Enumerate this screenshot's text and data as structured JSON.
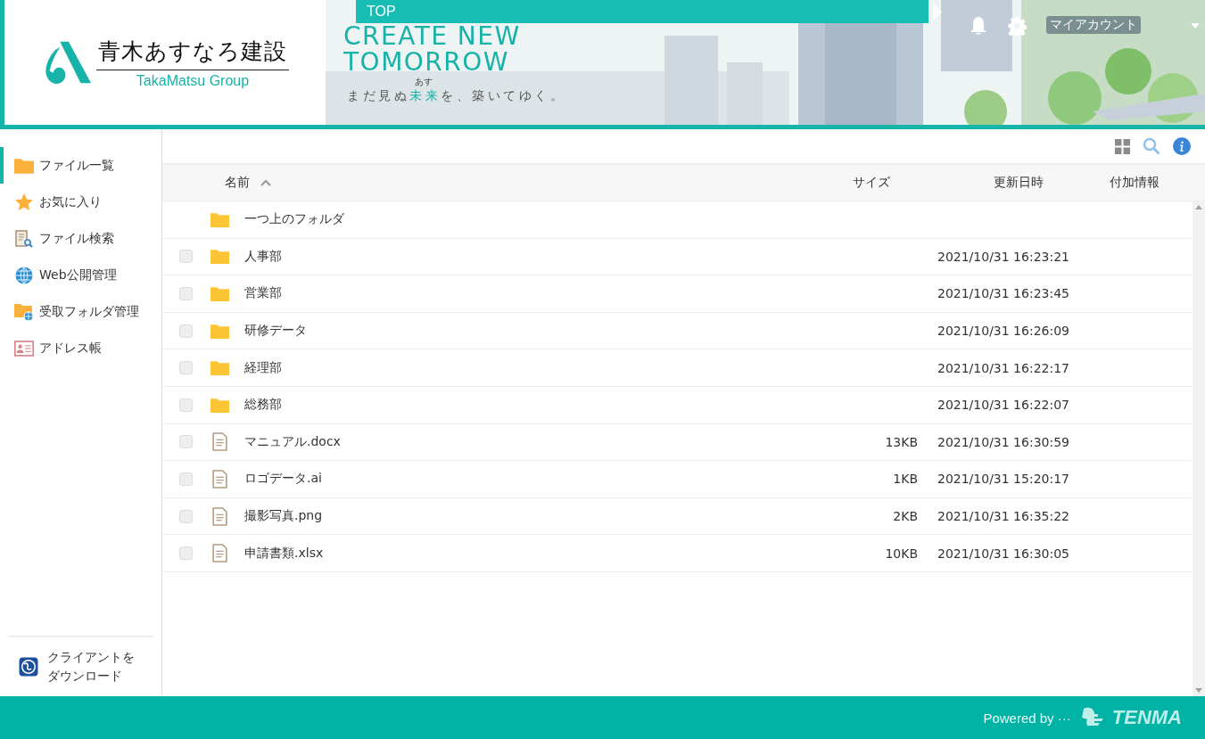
{
  "header": {
    "logo": {
      "name": "青木あすなろ建設",
      "group": "TakaMatsu Group"
    },
    "nav_label": "TOP",
    "banner": {
      "headline": [
        "CREATE NEW",
        "TOMORROW"
      ],
      "tagline": "まだ見ぬ**未来**を、築いてゆく。",
      "ruby": "あす"
    },
    "account": "マイアカウント"
  },
  "sidebar": {
    "items": [
      {
        "label": "ファイル一覧",
        "kind": "folder",
        "selected": true
      },
      {
        "label": "お気に入り",
        "kind": "star",
        "selected": false
      },
      {
        "label": "ファイル検索",
        "kind": "search",
        "selected": false
      },
      {
        "label": "Web公開管理",
        "kind": "globe",
        "selected": false
      },
      {
        "label": "受取フォルダ管理",
        "kind": "inbox",
        "selected": false
      },
      {
        "label": "アドレス帳",
        "kind": "contacts",
        "selected": false
      }
    ],
    "download": [
      "クライアントを",
      "ダウンロード"
    ]
  },
  "table": {
    "columns": [
      {
        "label": "名前",
        "sorted": true
      },
      {
        "label": "サイズ",
        "sorted": false
      },
      {
        "label": "更新日時",
        "sorted": false
      },
      {
        "label": "付加情報",
        "sorted": false
      }
    ],
    "rows": [
      {
        "kind": "parent",
        "name": "一つ上のフォルダ"
      },
      {
        "kind": "folder",
        "name": "人事部",
        "date": "2021/10/31 16:23:21",
        "checked": false
      },
      {
        "kind": "folder",
        "name": "営業部",
        "date": "2021/10/31 16:23:45",
        "checked": false
      },
      {
        "kind": "folder",
        "name": "研修データ",
        "date": "2021/10/31 16:26:09",
        "checked": false
      },
      {
        "kind": "folder",
        "name": "経理部",
        "date": "2021/10/31 16:22:17",
        "checked": false
      },
      {
        "kind": "folder",
        "name": "総務部",
        "date": "2021/10/31 16:22:07",
        "checked": false
      },
      {
        "kind": "file",
        "name": "マニュアル.docx",
        "size": "13KB",
        "date": "2021/10/31 16:30:59",
        "checked": false
      },
      {
        "kind": "file",
        "name": "ロゴデータ.ai",
        "size": "1KB",
        "date": "2021/10/31 15:20:17",
        "checked": false
      },
      {
        "kind": "file",
        "name": "撮影写真.png",
        "size": "2KB",
        "date": "2021/10/31 16:35:22",
        "checked": false
      },
      {
        "kind": "file",
        "name": "申請書類.xlsx",
        "size": "10KB",
        "date": "2021/10/31 16:30:05",
        "checked": false
      }
    ]
  },
  "footer": {
    "powered": "Powered by ···",
    "brand": "TENMA"
  }
}
